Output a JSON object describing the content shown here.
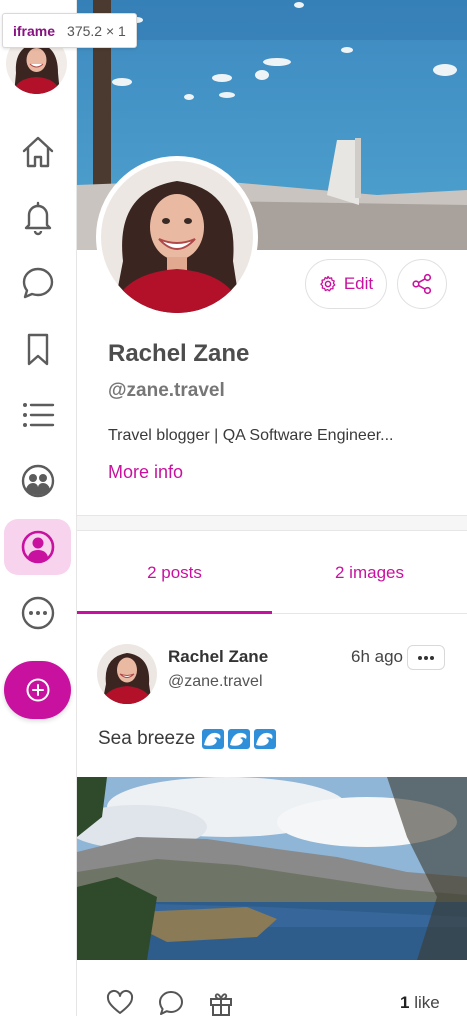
{
  "devtools_badge": {
    "tag": "iframe",
    "dimensions": "375.2 × 1"
  },
  "sidebar": {
    "items": [
      {
        "name": "home",
        "icon": "home-icon"
      },
      {
        "name": "notifications",
        "icon": "bell-icon"
      },
      {
        "name": "messages",
        "icon": "chat-bubble-icon"
      },
      {
        "name": "bookmarks",
        "icon": "bookmark-icon"
      },
      {
        "name": "lists",
        "icon": "list-icon"
      },
      {
        "name": "groups",
        "icon": "group-icon"
      },
      {
        "name": "profile",
        "icon": "user-circle-icon",
        "active": true
      },
      {
        "name": "more",
        "icon": "more-horizontal-icon"
      }
    ],
    "compose_icon": "plus-circle-icon"
  },
  "profile": {
    "name": "Rachel Zane",
    "handle": "@zane.travel",
    "bio": "Travel blogger | QA Software Engineer...",
    "more_info_label": "More info",
    "edit_label": "Edit"
  },
  "tabs": [
    {
      "label": "2 posts",
      "active": true
    },
    {
      "label": "2 images",
      "active": false
    }
  ],
  "post": {
    "author": "Rachel Zane",
    "handle": "@zane.travel",
    "time": "6h ago",
    "text": "Sea breeze",
    "emoji": "wave-icon ×3",
    "likes_count": "1",
    "likes_label": "like"
  },
  "colors": {
    "accent": "#c8129f",
    "active_nav_bg": "#f7d3ee",
    "border": "#e6e6e6"
  }
}
